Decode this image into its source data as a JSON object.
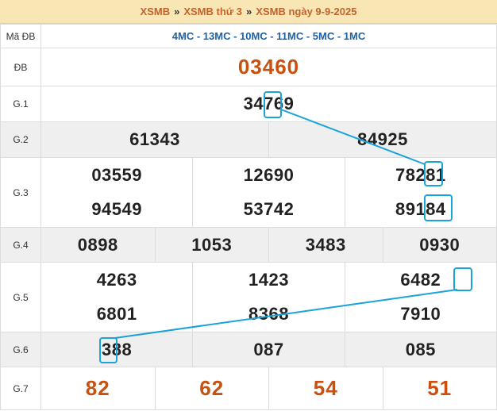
{
  "header": {
    "crumb1": "XSMB",
    "crumb2": "XSMB thứ 3",
    "crumb3": "XSMB ngày 9-9-2025",
    "separator": "»"
  },
  "table": {
    "code_label": "Mã ĐB",
    "codes": "4MC - 13MC - 10MC - 11MC - 5MC - 1MC",
    "db": {
      "label": "ĐB",
      "value": "03460"
    },
    "g1": {
      "label": "G.1",
      "value": "34769"
    },
    "g2": {
      "label": "G.2",
      "values": [
        "61343",
        "84925"
      ]
    },
    "g3": {
      "label": "G.3",
      "values": [
        "03559",
        "12690",
        "78281",
        "94549",
        "53742",
        "89184"
      ]
    },
    "g4": {
      "label": "G.4",
      "values": [
        "0898",
        "1053",
        "3483",
        "0930"
      ]
    },
    "g5": {
      "label": "G.5",
      "values": [
        "4263",
        "1423",
        "6482",
        "6801",
        "8368",
        "7910"
      ]
    },
    "g6": {
      "label": "G.6",
      "values": [
        "388",
        "087",
        "085"
      ]
    },
    "g7": {
      "label": "G.7",
      "values": [
        "82",
        "62",
        "54",
        "51"
      ]
    }
  },
  "colors": {
    "accent_red": "#c9500f",
    "code_blue": "#1d63a6",
    "highlight_cyan": "#1aa3d9",
    "title_bg": "#f8e7b5"
  }
}
